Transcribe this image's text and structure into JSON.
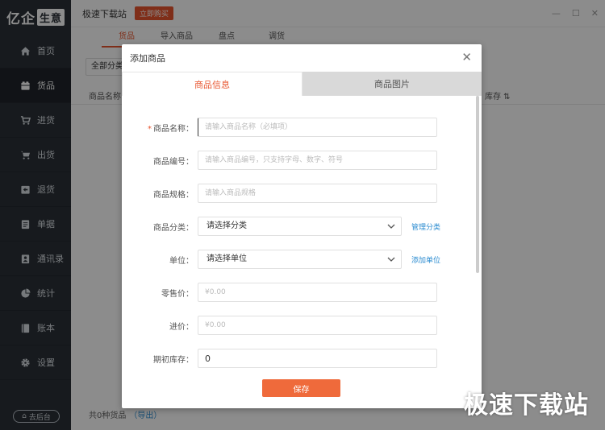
{
  "app": {
    "logo_text": "亿企",
    "logo_box": "生意",
    "window_title": "极速下载站",
    "buy_button": "立即购买"
  },
  "sidebar": {
    "items": [
      {
        "label": "首页",
        "icon": "home-icon"
      },
      {
        "label": "货品",
        "icon": "box-icon"
      },
      {
        "label": "进货",
        "icon": "cart-in-icon"
      },
      {
        "label": "出货",
        "icon": "cart-out-icon"
      },
      {
        "label": "退货",
        "icon": "return-icon"
      },
      {
        "label": "单据",
        "icon": "document-icon"
      },
      {
        "label": "通讯录",
        "icon": "contacts-icon"
      },
      {
        "label": "统计",
        "icon": "chart-icon"
      },
      {
        "label": "账本",
        "icon": "ledger-icon"
      },
      {
        "label": "设置",
        "icon": "gear-icon"
      }
    ],
    "active_index": 1,
    "backstage_label": "去后台"
  },
  "main": {
    "tabs": [
      "货品",
      "导入商品",
      "盘点",
      "调货"
    ],
    "active_tab": 0,
    "category_select": "全部分类",
    "columns": {
      "name": "商品名称",
      "stock": "库存 ⇅"
    },
    "footer_count": "共0种货品",
    "footer_export": "（导出）"
  },
  "dialog": {
    "title": "添加商品",
    "tabs": [
      "商品信息",
      "商品图片"
    ],
    "fields": [
      {
        "label": "商品名称：",
        "required": true,
        "placeholder": "请输入商品名称（必填项）",
        "value": ""
      },
      {
        "label": "商品编号：",
        "required": false,
        "placeholder": "请输入商品编号，只支持字母、数字、符号",
        "value": ""
      },
      {
        "label": "商品规格：",
        "required": false,
        "placeholder": "请输入商品规格",
        "value": ""
      },
      {
        "label": "商品分类：",
        "required": false,
        "select_value": "请选择分类",
        "link": "管理分类"
      },
      {
        "label": "单位：",
        "required": false,
        "select_value": "请选择单位",
        "link": "添加单位"
      },
      {
        "label": "零售价：",
        "required": false,
        "placeholder": "¥0.00",
        "value": ""
      },
      {
        "label": "进价：",
        "required": false,
        "placeholder": "¥0.00",
        "value": ""
      },
      {
        "label": "期初库存：",
        "required": false,
        "placeholder": "",
        "value": "0"
      }
    ],
    "save_button": "保存",
    "required_mark": "*"
  },
  "watermark": "极速下载站",
  "colors": {
    "accent": "#e8552f",
    "sidebar_bg": "#2a3037",
    "link": "#2a8bd0"
  }
}
